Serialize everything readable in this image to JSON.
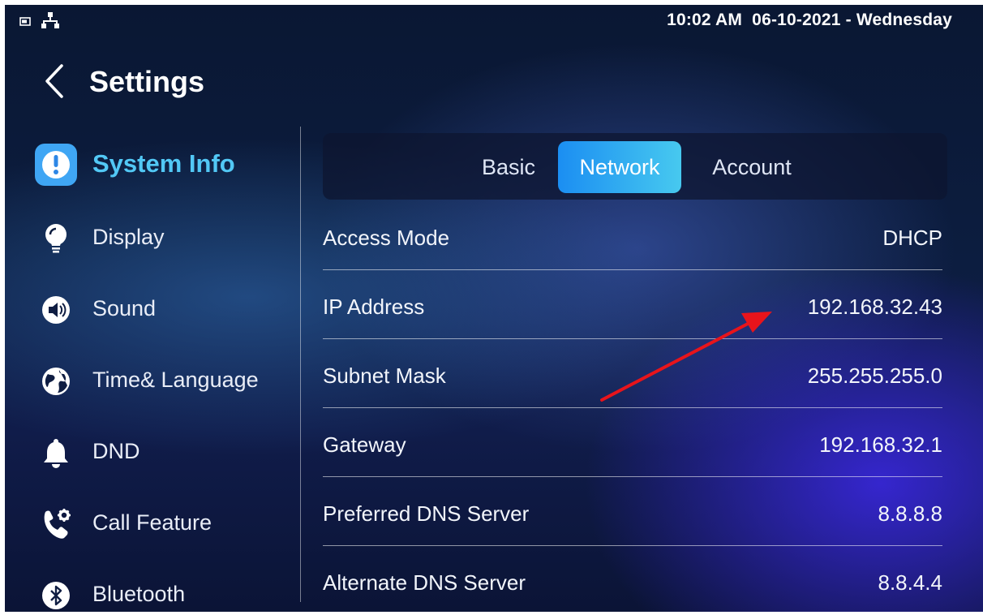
{
  "status_bar": {
    "datetime": "10:02 AM  06-10-2021 - Wednesday",
    "icons": [
      "screen-cast-icon",
      "network-icon"
    ]
  },
  "header": {
    "title": "Settings",
    "back_icon": "chevron-left-icon"
  },
  "sidebar": {
    "items": [
      {
        "label": "System Info",
        "icon": "info-icon",
        "active": true
      },
      {
        "label": "Display",
        "icon": "bulb-icon"
      },
      {
        "label": "Sound",
        "icon": "speaker-icon"
      },
      {
        "label": "Time& Language",
        "icon": "globe-icon"
      },
      {
        "label": "DND",
        "icon": "bell-icon"
      },
      {
        "label": "Call Feature",
        "icon": "phone-settings-icon"
      },
      {
        "label": "Bluetooth",
        "icon": "bluetooth-icon"
      }
    ]
  },
  "tabs": [
    {
      "label": "Basic"
    },
    {
      "label": "Network",
      "active": true
    },
    {
      "label": "Account"
    }
  ],
  "network": {
    "rows": [
      {
        "label": "Access Mode",
        "value": "DHCP"
      },
      {
        "label": "IP Address",
        "value": "192.168.32.43"
      },
      {
        "label": "Subnet Mask",
        "value": "255.255.255.0"
      },
      {
        "label": "Gateway",
        "value": "192.168.32.1"
      },
      {
        "label": "Preferred DNS Server",
        "value": "8.8.8.8"
      },
      {
        "label": "Alternate DNS Server",
        "value": "8.8.4.4"
      }
    ]
  },
  "colors": {
    "accent": "#52c8f5",
    "tab_active_start": "#1b8ef2",
    "tab_active_end": "#47c9ef",
    "annotation_arrow": "#e8141b"
  }
}
